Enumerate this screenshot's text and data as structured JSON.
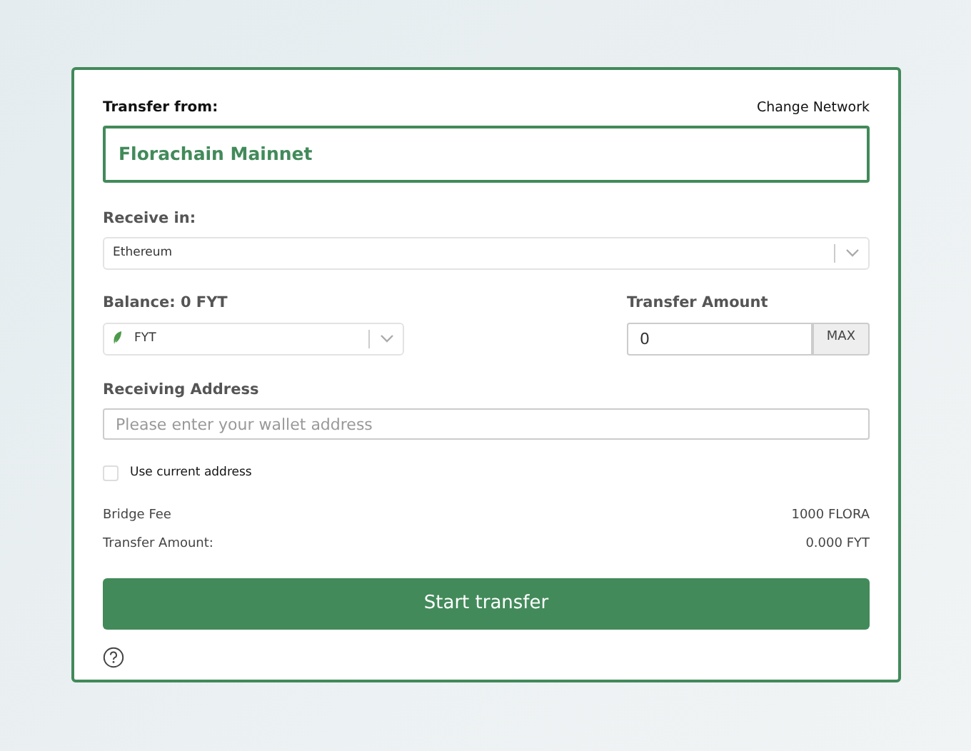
{
  "transfer_from": {
    "label": "Transfer from:",
    "change_link": "Change Network",
    "network": "Florachain Mainnet"
  },
  "receive_in": {
    "label": "Receive in:",
    "value": "Ethereum"
  },
  "balance": {
    "label": "Balance: 0 FYT",
    "token": "FYT"
  },
  "amount": {
    "label": "Transfer Amount",
    "value": "0",
    "max_button": "MAX"
  },
  "address": {
    "label": "Receiving Address",
    "placeholder": "Please enter your wallet address"
  },
  "use_current": {
    "label": "Use current address",
    "checked": false
  },
  "summary": [
    {
      "label": "Bridge Fee",
      "value": "1000 FLORA"
    },
    {
      "label": "Transfer Amount:",
      "value": "0.000 FYT"
    }
  ],
  "submit": "Start transfer"
}
